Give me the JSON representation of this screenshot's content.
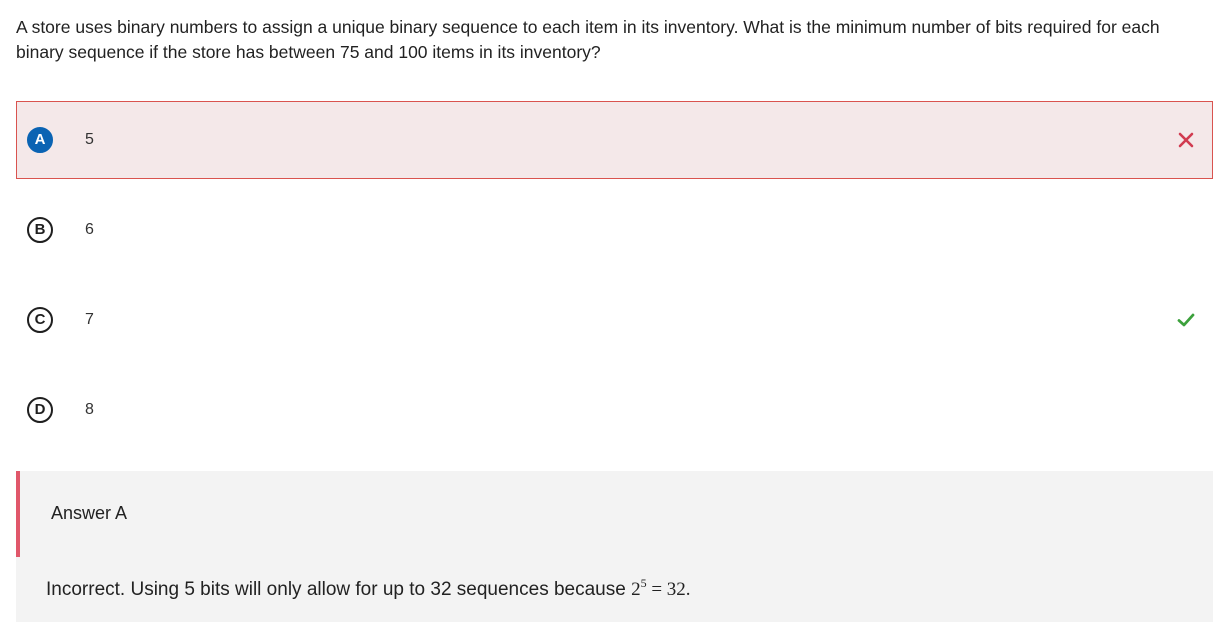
{
  "question": {
    "text": "A store uses binary numbers to assign a unique binary sequence to each item in its inventory. What is the minimum number of bits required for each binary sequence if the store has between 75 and 100 items in its inventory?"
  },
  "options": [
    {
      "letter": "A",
      "text": "5",
      "state": "selected-incorrect",
      "mark_icon": "x-icon"
    },
    {
      "letter": "B",
      "text": "6",
      "state": "unselected"
    },
    {
      "letter": "C",
      "text": "7",
      "state": "correct",
      "mark_icon": "checkmark-icon"
    },
    {
      "letter": "D",
      "text": "8",
      "state": "unselected"
    }
  ],
  "feedback": {
    "answer_label": "Answer A",
    "explanation_prefix": "Incorrect. Using 5 bits will only allow for up to 32 sequences because ",
    "math_base": "2",
    "math_exponent": "5",
    "math_rest": " = 32."
  },
  "colors": {
    "wrong_bg": "#f4e8e9",
    "wrong_border": "#d9534f",
    "selected_letter_bg": "#0a63b3",
    "x_mark": "#d13b50",
    "check_mark": "#3ca13c",
    "feedback_bar": "#e0576a",
    "feedback_bg": "#f3f3f3"
  }
}
